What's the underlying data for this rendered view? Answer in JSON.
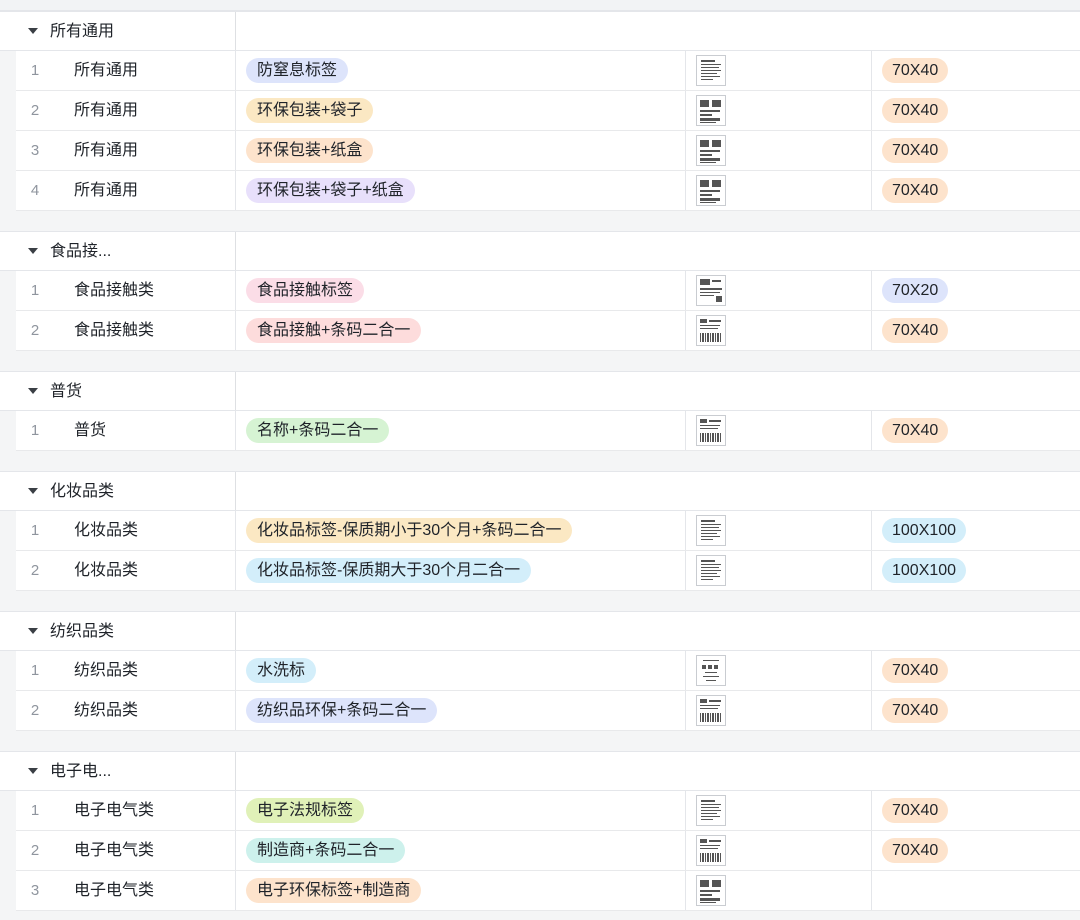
{
  "groups": [
    {
      "name": "所有通用",
      "rows": [
        {
          "index": "1",
          "category": "所有通用",
          "tag": "防窒息标签",
          "tag_color": "#dde4fb",
          "thumb": "text",
          "size": "70X40",
          "size_color": "#fde3cc"
        },
        {
          "index": "2",
          "category": "所有通用",
          "tag": "环保包装+袋子",
          "tag_color": "#fbe8c3",
          "thumb": "eco",
          "size": "70X40",
          "size_color": "#fde3cc"
        },
        {
          "index": "3",
          "category": "所有通用",
          "tag": "环保包装+纸盒",
          "tag_color": "#fde3cc",
          "thumb": "eco",
          "size": "70X40",
          "size_color": "#fde3cc"
        },
        {
          "index": "4",
          "category": "所有通用",
          "tag": "环保包装+袋子+纸盒",
          "tag_color": "#e8e0fb",
          "thumb": "eco",
          "size": "70X40",
          "size_color": "#fde3cc"
        }
      ]
    },
    {
      "name": "食品接...",
      "rows": [
        {
          "index": "1",
          "category": "食品接触类",
          "tag": "食品接触标签",
          "tag_color": "#fbdde7",
          "thumb": "food",
          "size": "70X20",
          "size_color": "#dde4fb"
        },
        {
          "index": "2",
          "category": "食品接触类",
          "tag": "食品接触+条码二合一",
          "tag_color": "#fddcdc",
          "thumb": "barcode",
          "size": "70X40",
          "size_color": "#fde3cc"
        }
      ]
    },
    {
      "name": "普货",
      "rows": [
        {
          "index": "1",
          "category": "普货",
          "tag": "名称+条码二合一",
          "tag_color": "#d6f3d3",
          "thumb": "barcode",
          "size": "70X40",
          "size_color": "#fde3cc"
        }
      ]
    },
    {
      "name": "化妆品类",
      "rows": [
        {
          "index": "1",
          "category": "化妆品类",
          "tag": "化妆品标签-保质期小于30个月+条码二合一",
          "tag_color": "#fbe8c3",
          "thumb": "text",
          "size": "100X100",
          "size_color": "#d3eefa"
        },
        {
          "index": "2",
          "category": "化妆品类",
          "tag": "化妆品标签-保质期大于30个月二合一",
          "tag_color": "#d3eefa",
          "thumb": "text",
          "size": "100X100",
          "size_color": "#d3eefa"
        }
      ]
    },
    {
      "name": "纺织品类",
      "rows": [
        {
          "index": "1",
          "category": "纺织品类",
          "tag": "水洗标",
          "tag_color": "#d3eefa",
          "thumb": "wash",
          "size": "70X40",
          "size_color": "#fde3cc"
        },
        {
          "index": "2",
          "category": "纺织品类",
          "tag": "纺织品环保+条码二合一",
          "tag_color": "#dde4fb",
          "thumb": "barcode",
          "size": "70X40",
          "size_color": "#fde3cc"
        }
      ]
    },
    {
      "name": "电子电...",
      "rows": [
        {
          "index": "1",
          "category": "电子电气类",
          "tag": "电子法规标签",
          "tag_color": "#e0f1b8",
          "thumb": "text",
          "size": "70X40",
          "size_color": "#fde3cc"
        },
        {
          "index": "2",
          "category": "电子电气类",
          "tag": "制造商+条码二合一",
          "tag_color": "#cdf1ec",
          "thumb": "barcode",
          "size": "70X40",
          "size_color": "#fde3cc"
        },
        {
          "index": "3",
          "category": "电子电气类",
          "tag": "电子环保标签+制造商",
          "tag_color": "#fde3cc",
          "thumb": "eco",
          "size": "",
          "size_color": ""
        }
      ]
    }
  ]
}
